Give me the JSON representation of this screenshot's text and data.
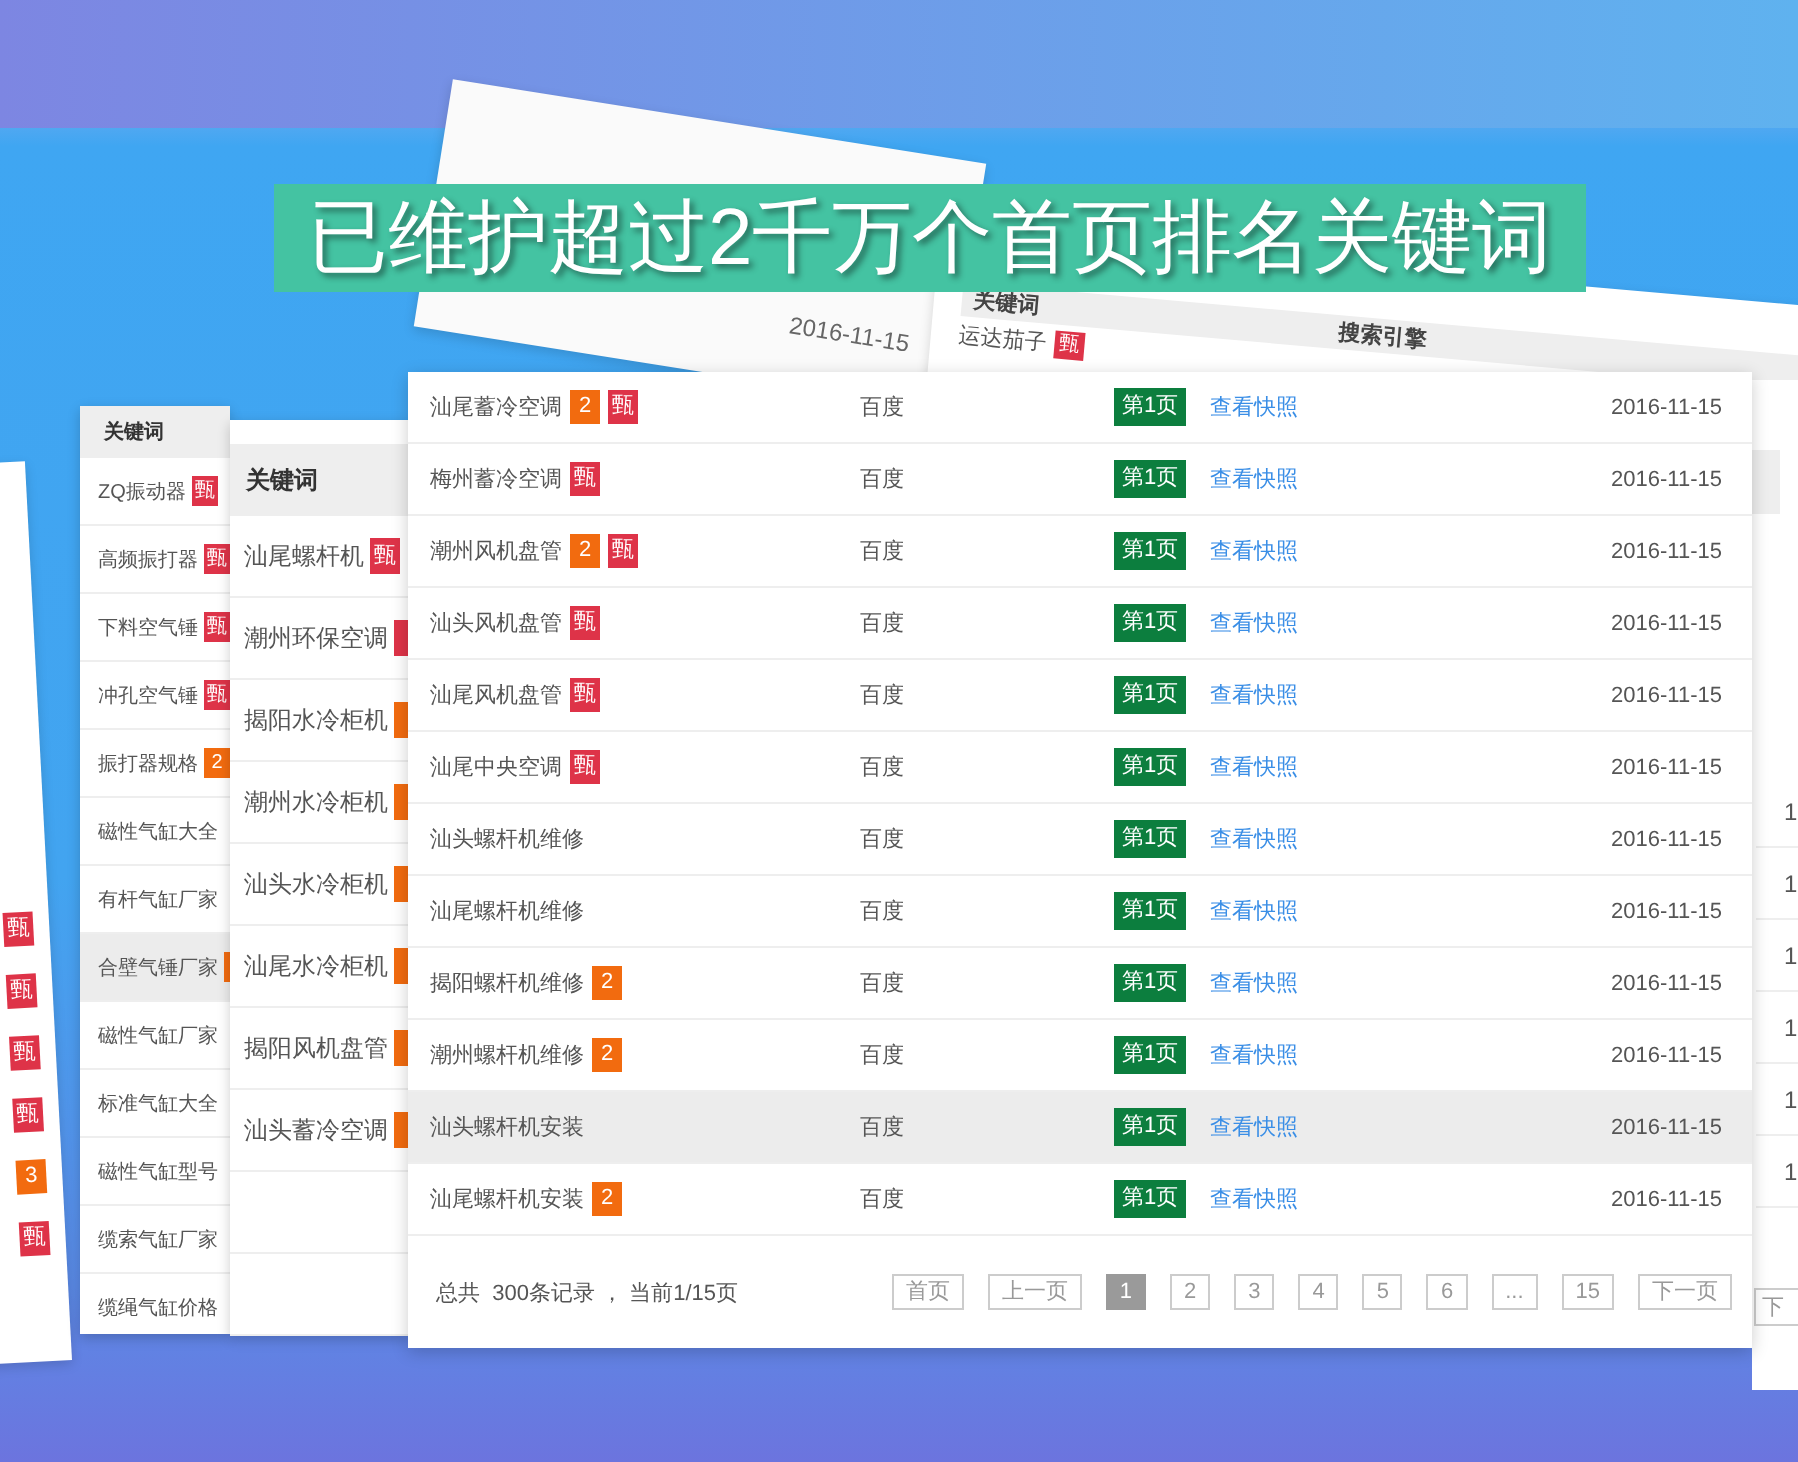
{
  "banner": {
    "title": "已维护超过2千万个首页排名关键词"
  },
  "far_left_card": {
    "badges": [
      {
        "kind": "baidu",
        "text": "甄"
      },
      {
        "kind": "baidu",
        "text": "甄"
      },
      {
        "kind": "baidu",
        "text": "甄"
      },
      {
        "kind": "baidu",
        "text": "甄"
      },
      {
        "kind": "rank",
        "text": "3"
      },
      {
        "kind": "baidu",
        "text": "甄"
      }
    ]
  },
  "top_date_card": {
    "date": "2016-11-15"
  },
  "top_right_card": {
    "header": "关键词",
    "column_2_header": "搜索引擎",
    "rows": [
      {
        "keyword": "运达茄子",
        "badges": [
          {
            "kind": "baidu",
            "text": "甄"
          }
        ]
      }
    ]
  },
  "left_card": {
    "header": "关键词",
    "rows": [
      {
        "keyword": "ZQ振动器",
        "hovered": false,
        "badges": [
          {
            "kind": "baidu",
            "text": "甄"
          }
        ]
      },
      {
        "keyword": "高频振打器",
        "hovered": false,
        "badges": [
          {
            "kind": "baidu",
            "text": "甄"
          }
        ]
      },
      {
        "keyword": "下料空气锤",
        "hovered": false,
        "badges": [
          {
            "kind": "baidu",
            "text": "甄"
          }
        ]
      },
      {
        "keyword": "冲孔空气锤",
        "hovered": false,
        "badges": [
          {
            "kind": "baidu",
            "text": "甄"
          }
        ]
      },
      {
        "keyword": "振打器规格",
        "hovered": false,
        "badges": [
          {
            "kind": "rank",
            "text": "2"
          }
        ]
      },
      {
        "keyword": "磁性气缸大全",
        "hovered": false,
        "badges": []
      },
      {
        "keyword": "有杆气缸厂家",
        "hovered": false,
        "badges": []
      },
      {
        "keyword": "合壁气锤厂家",
        "hovered": true,
        "badges": [
          {
            "kind": "rank"
          }
        ]
      },
      {
        "keyword": "磁性气缸厂家",
        "hovered": false,
        "badges": []
      },
      {
        "keyword": "标准气缸大全",
        "hovered": false,
        "badges": []
      },
      {
        "keyword": "磁性气缸型号",
        "hovered": false,
        "badges": []
      },
      {
        "keyword": "缆索气缸厂家",
        "hovered": false,
        "badges": []
      },
      {
        "keyword": "缆绳气缸价格",
        "hovered": false,
        "badges": []
      }
    ]
  },
  "middle_card": {
    "header": "关键词",
    "rows": [
      {
        "keyword": "汕尾螺杆机",
        "badges": [
          {
            "kind": "baidu",
            "text": "甄"
          }
        ]
      },
      {
        "keyword": "潮州环保空调",
        "badges": [
          {
            "kind": "baidu"
          }
        ]
      },
      {
        "keyword": "揭阳水冷柜机",
        "badges": [
          {
            "kind": "rank"
          }
        ]
      },
      {
        "keyword": "潮州水冷柜机",
        "badges": [
          {
            "kind": "rank"
          }
        ]
      },
      {
        "keyword": "汕头水冷柜机",
        "badges": [
          {
            "kind": "rank"
          }
        ]
      },
      {
        "keyword": "汕尾水冷柜机",
        "badges": [
          {
            "kind": "rank"
          }
        ]
      },
      {
        "keyword": "揭阳风机盘管",
        "badges": [
          {
            "kind": "rank"
          }
        ]
      },
      {
        "keyword": "汕头蓄冷空调",
        "badges": [
          {
            "kind": "rank"
          }
        ]
      }
    ]
  },
  "table": {
    "rows": [
      {
        "keyword": "汕尾蓄冷空调",
        "badges": [
          {
            "kind": "rank",
            "text": "2"
          },
          {
            "kind": "baidu",
            "text": "甄"
          }
        ],
        "engine": "百度",
        "page": "第1页",
        "link": "查看快照",
        "date": "2016-11-15",
        "hovered": false
      },
      {
        "keyword": "梅州蓄冷空调",
        "badges": [
          {
            "kind": "baidu",
            "text": "甄"
          }
        ],
        "engine": "百度",
        "page": "第1页",
        "link": "查看快照",
        "date": "2016-11-15",
        "hovered": false
      },
      {
        "keyword": "潮州风机盘管",
        "badges": [
          {
            "kind": "rank",
            "text": "2"
          },
          {
            "kind": "baidu",
            "text": "甄"
          }
        ],
        "engine": "百度",
        "page": "第1页",
        "link": "查看快照",
        "date": "2016-11-15",
        "hovered": false
      },
      {
        "keyword": "汕头风机盘管",
        "badges": [
          {
            "kind": "baidu",
            "text": "甄"
          }
        ],
        "engine": "百度",
        "page": "第1页",
        "link": "查看快照",
        "date": "2016-11-15",
        "hovered": false
      },
      {
        "keyword": "汕尾风机盘管",
        "badges": [
          {
            "kind": "baidu",
            "text": "甄"
          }
        ],
        "engine": "百度",
        "page": "第1页",
        "link": "查看快照",
        "date": "2016-11-15",
        "hovered": false
      },
      {
        "keyword": "汕尾中央空调",
        "badges": [
          {
            "kind": "baidu",
            "text": "甄"
          }
        ],
        "engine": "百度",
        "page": "第1页",
        "link": "查看快照",
        "date": "2016-11-15",
        "hovered": false
      },
      {
        "keyword": "汕头螺杆机维修",
        "badges": [],
        "engine": "百度",
        "page": "第1页",
        "link": "查看快照",
        "date": "2016-11-15",
        "hovered": false
      },
      {
        "keyword": "汕尾螺杆机维修",
        "badges": [],
        "engine": "百度",
        "page": "第1页",
        "link": "查看快照",
        "date": "2016-11-15",
        "hovered": false
      },
      {
        "keyword": "揭阳螺杆机维修",
        "badges": [
          {
            "kind": "rank",
            "text": "2"
          }
        ],
        "engine": "百度",
        "page": "第1页",
        "link": "查看快照",
        "date": "2016-11-15",
        "hovered": false
      },
      {
        "keyword": "潮州螺杆机维修",
        "badges": [
          {
            "kind": "rank",
            "text": "2"
          }
        ],
        "engine": "百度",
        "page": "第1页",
        "link": "查看快照",
        "date": "2016-11-15",
        "hovered": false
      },
      {
        "keyword": "汕头螺杆机安装",
        "badges": [],
        "engine": "百度",
        "page": "第1页",
        "link": "查看快照",
        "date": "2016-11-15",
        "hovered": true
      },
      {
        "keyword": "汕尾螺杆机安装",
        "badges": [
          {
            "kind": "rank",
            "text": "2"
          }
        ],
        "engine": "百度",
        "page": "第1页",
        "link": "查看快照",
        "date": "2016-11-15",
        "hovered": false
      }
    ],
    "summary": "总共  300条记录 ， 当前1/15页",
    "pager": [
      {
        "label": "首页",
        "selected": false
      },
      {
        "label": "上一页",
        "selected": false
      },
      {
        "label": "1",
        "selected": true
      },
      {
        "label": "2",
        "selected": false
      },
      {
        "label": "3",
        "selected": false
      },
      {
        "label": "4",
        "selected": false
      },
      {
        "label": "5",
        "selected": false
      },
      {
        "label": "6",
        "selected": false
      },
      {
        "label": "...",
        "selected": false
      },
      {
        "label": "15",
        "selected": false
      },
      {
        "label": "下一页",
        "selected": false
      }
    ]
  },
  "right_card": {
    "cells": [
      "1",
      "1",
      "1",
      "1",
      "1",
      "1"
    ],
    "button": "下"
  }
}
